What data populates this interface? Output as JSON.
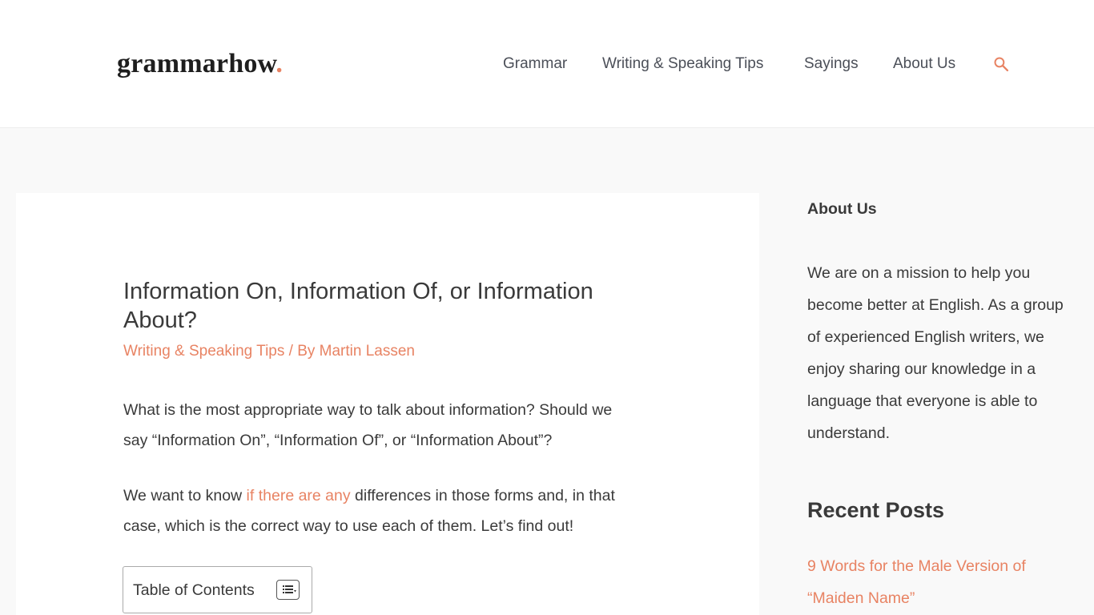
{
  "header": {
    "logo_text": "grammarhow",
    "logo_dot": ".",
    "nav": [
      {
        "label": "Grammar"
      },
      {
        "label": "Writing & Speaking Tips"
      },
      {
        "label": "Sayings"
      },
      {
        "label": "About Us"
      }
    ],
    "search_icon": "search-icon"
  },
  "article": {
    "title": "Information On, Information Of, or Information About?",
    "category": "Writing & Speaking Tips",
    "by_prefix": " / By ",
    "author": "Martin Lassen",
    "paragraph1": "What is the most appropriate way to talk about information? Should we say “Information On”, “Information Of”, or “Information About”?",
    "paragraph2_before": "We want to know ",
    "paragraph2_link": "if there are any",
    "paragraph2_after": " differences in those forms and, in that case, which is the correct way to use each of them. Let’s find out!",
    "toc_title": "Table of Contents",
    "toc_icon": "list-toggle-icon"
  },
  "sidebar": {
    "about_title": "About Us",
    "about_text": "We are on a mission to help you become better at English. As a group of experienced English writers, we enjoy sharing our knowledge in a language that everyone is able to understand.",
    "recent_heading": "Recent Posts",
    "recent_posts": [
      {
        "title": "9 Words for the Male Version of “Maiden Name”"
      }
    ]
  },
  "colors": {
    "accent": "#e88363",
    "text": "#3a3a3a",
    "nav_text": "#4b4f58",
    "page_bg": "#f9f9f9"
  }
}
